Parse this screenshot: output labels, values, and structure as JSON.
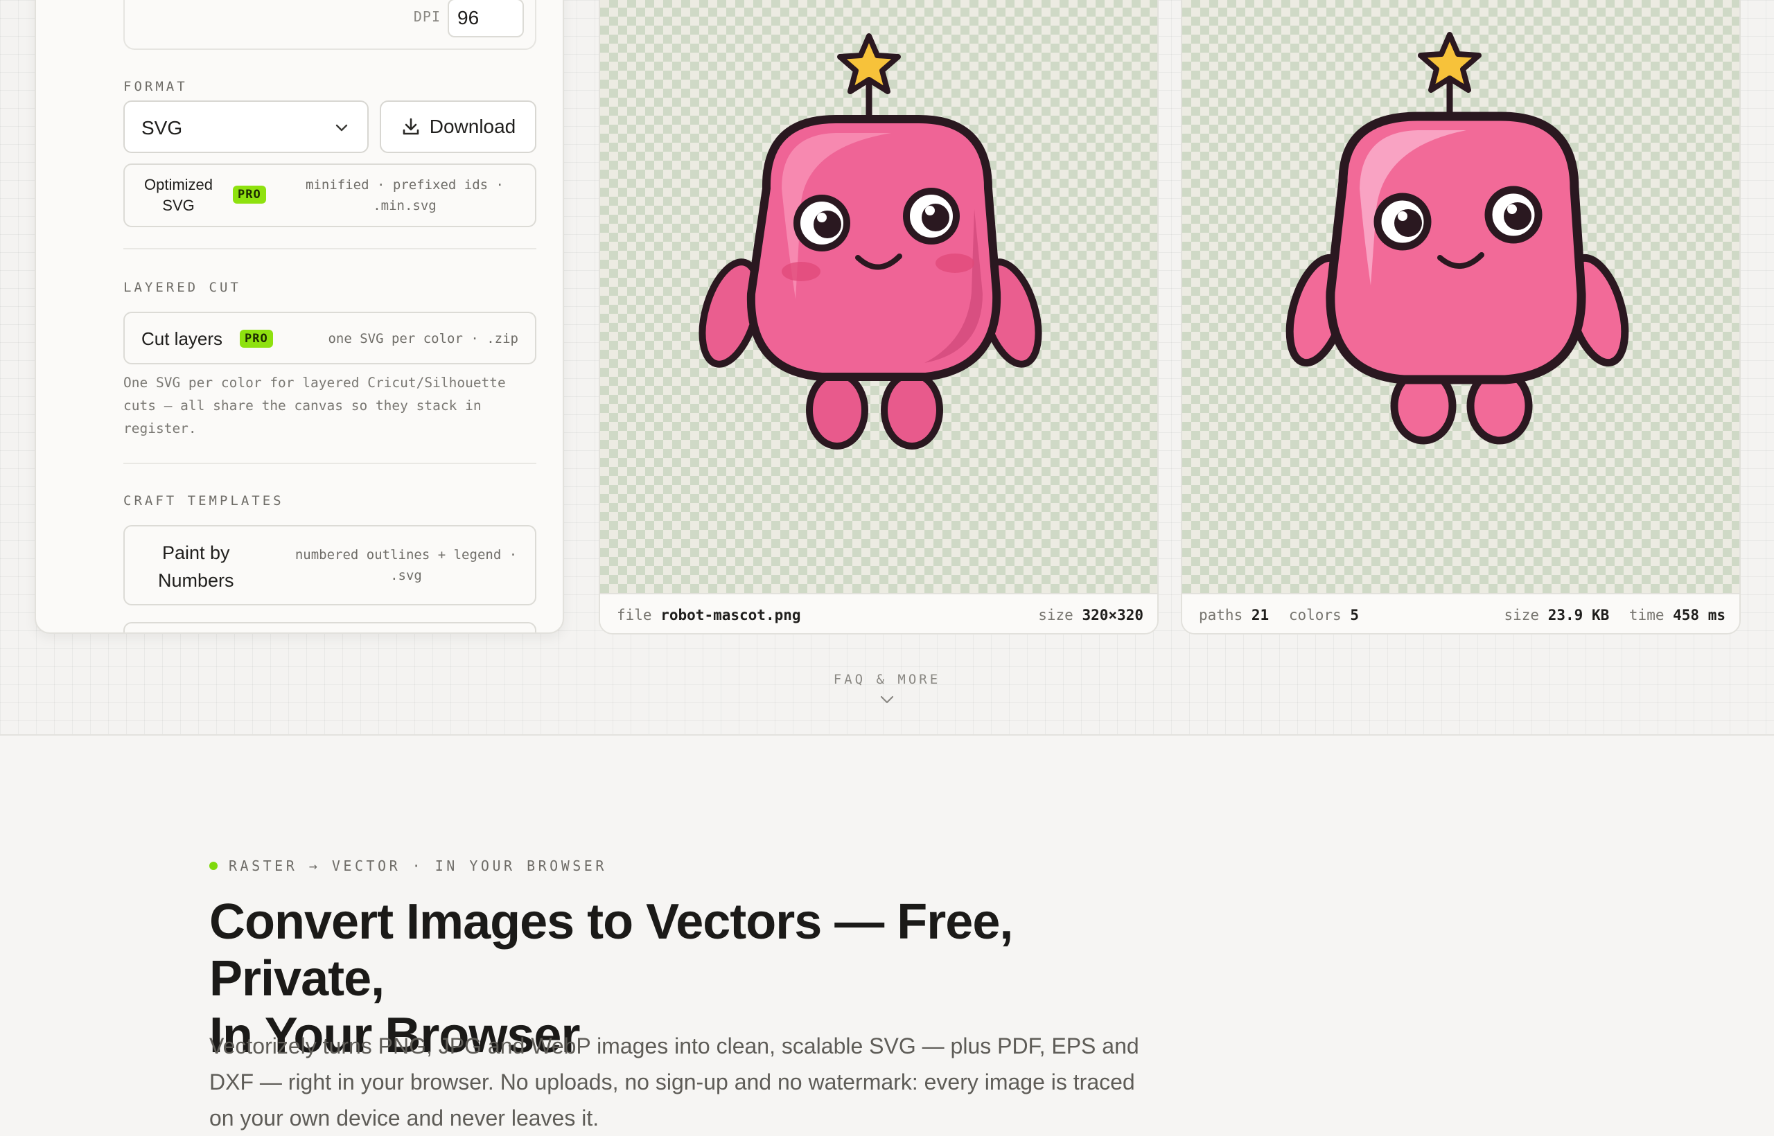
{
  "export": {
    "dpi_label": "DPI",
    "dpi_value": "96",
    "format_label": "FORMAT",
    "format_value": "SVG",
    "download_label": "Download",
    "optimized": {
      "title_line1": "Optimized",
      "title_line2": "SVG",
      "badge": "PRO",
      "meta_line1": "minified · prefixed ids ·",
      "meta_line2": ".min.svg"
    },
    "layered_label": "LAYERED CUT",
    "cut_layers": {
      "title": "Cut layers",
      "badge": "PRO",
      "meta": "one SVG per color · .zip"
    },
    "layered_desc": "One SVG per color for layered Cricut/Silhouette cuts — all share the canvas so they stack in register.",
    "craft_label": "CRAFT TEMPLATES",
    "paint_by_numbers": {
      "title_line1": "Paint by",
      "title_line2": "Numbers",
      "meta_line1": "numbered outlines + legend ·",
      "meta_line2": ".svg"
    }
  },
  "original_preview": {
    "file_key": "file",
    "file_value": "robot-mascot.png",
    "size_key": "size",
    "size_value": "320×320"
  },
  "vector_preview": {
    "paths_key": "paths",
    "paths_value": "21",
    "colors_key": "colors",
    "colors_value": "5",
    "size_key": "size",
    "size_value": "23.9 KB",
    "time_key": "time",
    "time_value": "458 ms"
  },
  "faq": {
    "label": "FAQ & MORE"
  },
  "hero": {
    "tag": "RASTER → VECTOR · IN YOUR BROWSER",
    "title_line1": "Convert Images to Vectors — Free, Private,",
    "title_line2": "In Your Browser",
    "body": "Vectorizely turns PNG, JPG and WebP images into clean, scalable SVG — plus PDF, EPS and DXF — right in your browser. No uploads, no sign-up and no watermark: every image is traced on your own device and never leaves it."
  },
  "colors": {
    "accent_green": "#8ee10f",
    "robot_pink": "#f26a98",
    "outline": "#2a1820",
    "star": "#f7c23a"
  }
}
